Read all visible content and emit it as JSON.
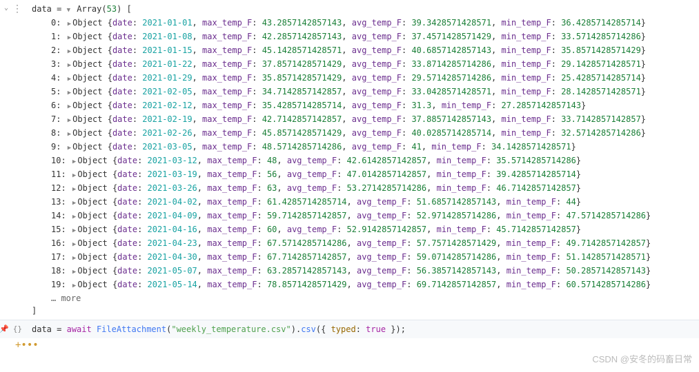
{
  "output": {
    "var_name": "data",
    "type_label": "Array",
    "length": 53,
    "rows": [
      {
        "idx": "0",
        "date": "2021-01-01",
        "max_temp_F": "43.2857142857143",
        "avg_temp_F": "39.3428571428571",
        "min_temp_F": "36.4285714285714"
      },
      {
        "idx": "1",
        "date": "2021-01-08",
        "max_temp_F": "42.2857142857143",
        "avg_temp_F": "37.4571428571429",
        "min_temp_F": "33.5714285714286"
      },
      {
        "idx": "2",
        "date": "2021-01-15",
        "max_temp_F": "45.1428571428571",
        "avg_temp_F": "40.6857142857143",
        "min_temp_F": "35.8571428571429"
      },
      {
        "idx": "3",
        "date": "2021-01-22",
        "max_temp_F": "37.8571428571429",
        "avg_temp_F": "33.8714285714286",
        "min_temp_F": "29.1428571428571"
      },
      {
        "idx": "4",
        "date": "2021-01-29",
        "max_temp_F": "35.8571428571429",
        "avg_temp_F": "29.5714285714286",
        "min_temp_F": "25.4285714285714"
      },
      {
        "idx": "5",
        "date": "2021-02-05",
        "max_temp_F": "34.7142857142857",
        "avg_temp_F": "33.0428571428571",
        "min_temp_F": "28.1428571428571"
      },
      {
        "idx": "6",
        "date": "2021-02-12",
        "max_temp_F": "35.4285714285714",
        "avg_temp_F": "31.3",
        "min_temp_F": "27.2857142857143"
      },
      {
        "idx": "7",
        "date": "2021-02-19",
        "max_temp_F": "42.7142857142857",
        "avg_temp_F": "37.8857142857143",
        "min_temp_F": "33.7142857142857"
      },
      {
        "idx": "8",
        "date": "2021-02-26",
        "max_temp_F": "45.8571428571429",
        "avg_temp_F": "40.0285714285714",
        "min_temp_F": "32.5714285714286"
      },
      {
        "idx": "9",
        "date": "2021-03-05",
        "max_temp_F": "48.5714285714286",
        "avg_temp_F": "41",
        "min_temp_F": "34.1428571428571"
      },
      {
        "idx": "10",
        "date": "2021-03-12",
        "max_temp_F": "48",
        "avg_temp_F": "42.6142857142857",
        "min_temp_F": "35.5714285714286"
      },
      {
        "idx": "11",
        "date": "2021-03-19",
        "max_temp_F": "56",
        "avg_temp_F": "47.0142857142857",
        "min_temp_F": "39.4285714285714"
      },
      {
        "idx": "12",
        "date": "2021-03-26",
        "max_temp_F": "63",
        "avg_temp_F": "53.2714285714286",
        "min_temp_F": "46.7142857142857"
      },
      {
        "idx": "13",
        "date": "2021-04-02",
        "max_temp_F": "61.4285714285714",
        "avg_temp_F": "51.6857142857143",
        "min_temp_F": "44"
      },
      {
        "idx": "14",
        "date": "2021-04-09",
        "max_temp_F": "59.7142857142857",
        "avg_temp_F": "52.9714285714286",
        "min_temp_F": "47.5714285714286"
      },
      {
        "idx": "15",
        "date": "2021-04-16",
        "max_temp_F": "60",
        "avg_temp_F": "52.9142857142857",
        "min_temp_F": "45.7142857142857"
      },
      {
        "idx": "16",
        "date": "2021-04-23",
        "max_temp_F": "67.5714285714286",
        "avg_temp_F": "57.7571428571429",
        "min_temp_F": "49.7142857142857"
      },
      {
        "idx": "17",
        "date": "2021-04-30",
        "max_temp_F": "67.7142857142857",
        "avg_temp_F": "59.0714285714286",
        "min_temp_F": "51.1428571428571"
      },
      {
        "idx": "18",
        "date": "2021-05-07",
        "max_temp_F": "63.2857142857143",
        "avg_temp_F": "56.3857142857143",
        "min_temp_F": "50.2857142857143"
      },
      {
        "idx": "19",
        "date": "2021-05-14",
        "max_temp_F": "78.8571428571429",
        "avg_temp_F": "69.7142857142857",
        "min_temp_F": "60.5714285714286"
      }
    ],
    "more_label": "… more",
    "object_label": "Object",
    "keys": {
      "date": "date",
      "max": "max_temp_F",
      "avg": "avg_temp_F",
      "min": "min_temp_F"
    }
  },
  "code": {
    "var": "data",
    "await": "await",
    "fn": "FileAttachment",
    "arg": "\"weekly_temperature.csv\"",
    "method": "csv",
    "opt_key": "typed",
    "opt_val": "true"
  },
  "watermark": "CSDN @安冬的码畜日常"
}
